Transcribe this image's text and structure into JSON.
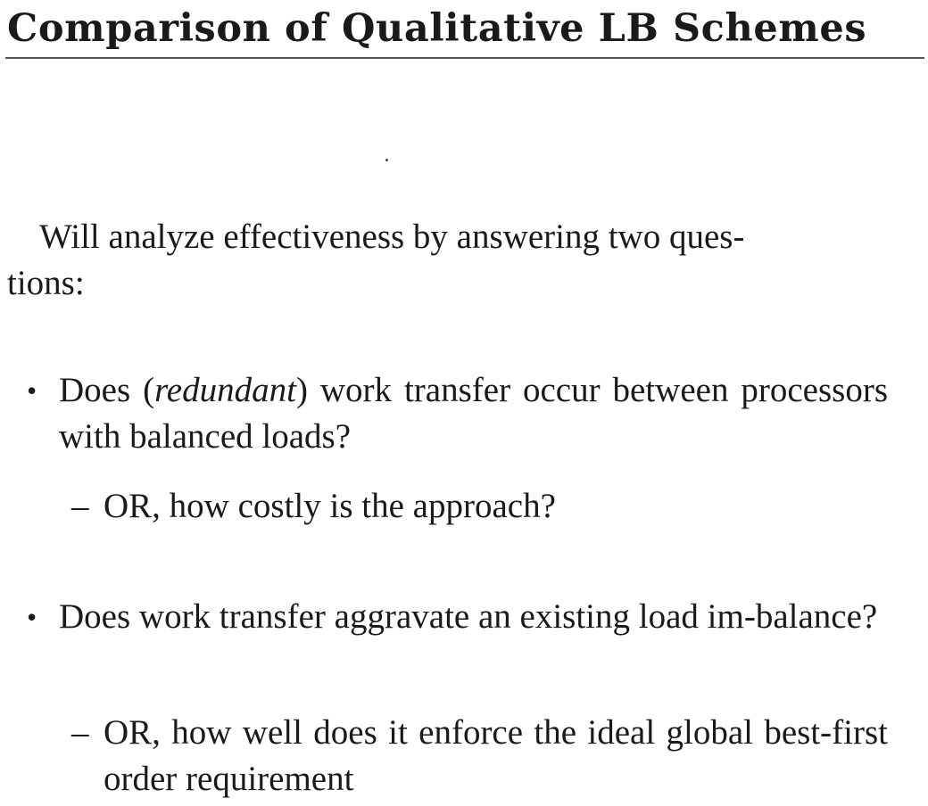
{
  "slide": {
    "title": "Comparison of Qualitative LB Schemes",
    "intro": {
      "line1": "Will analyze effectiveness by answering two ques-",
      "line2": "tions:"
    },
    "bullets": [
      {
        "marker": "•",
        "pre": "Does (",
        "emphasis": "redundant",
        "post": ") work transfer occur between processors with balanced loads?",
        "sub": {
          "marker": "–",
          "text": "OR, how costly is the approach?"
        }
      },
      {
        "marker": "•",
        "text": "Does work transfer aggravate an existing load im-balance?",
        "sub": {
          "marker": "–",
          "text": "OR, how well does it enforce the ideal global best-first order requirement"
        }
      }
    ]
  }
}
